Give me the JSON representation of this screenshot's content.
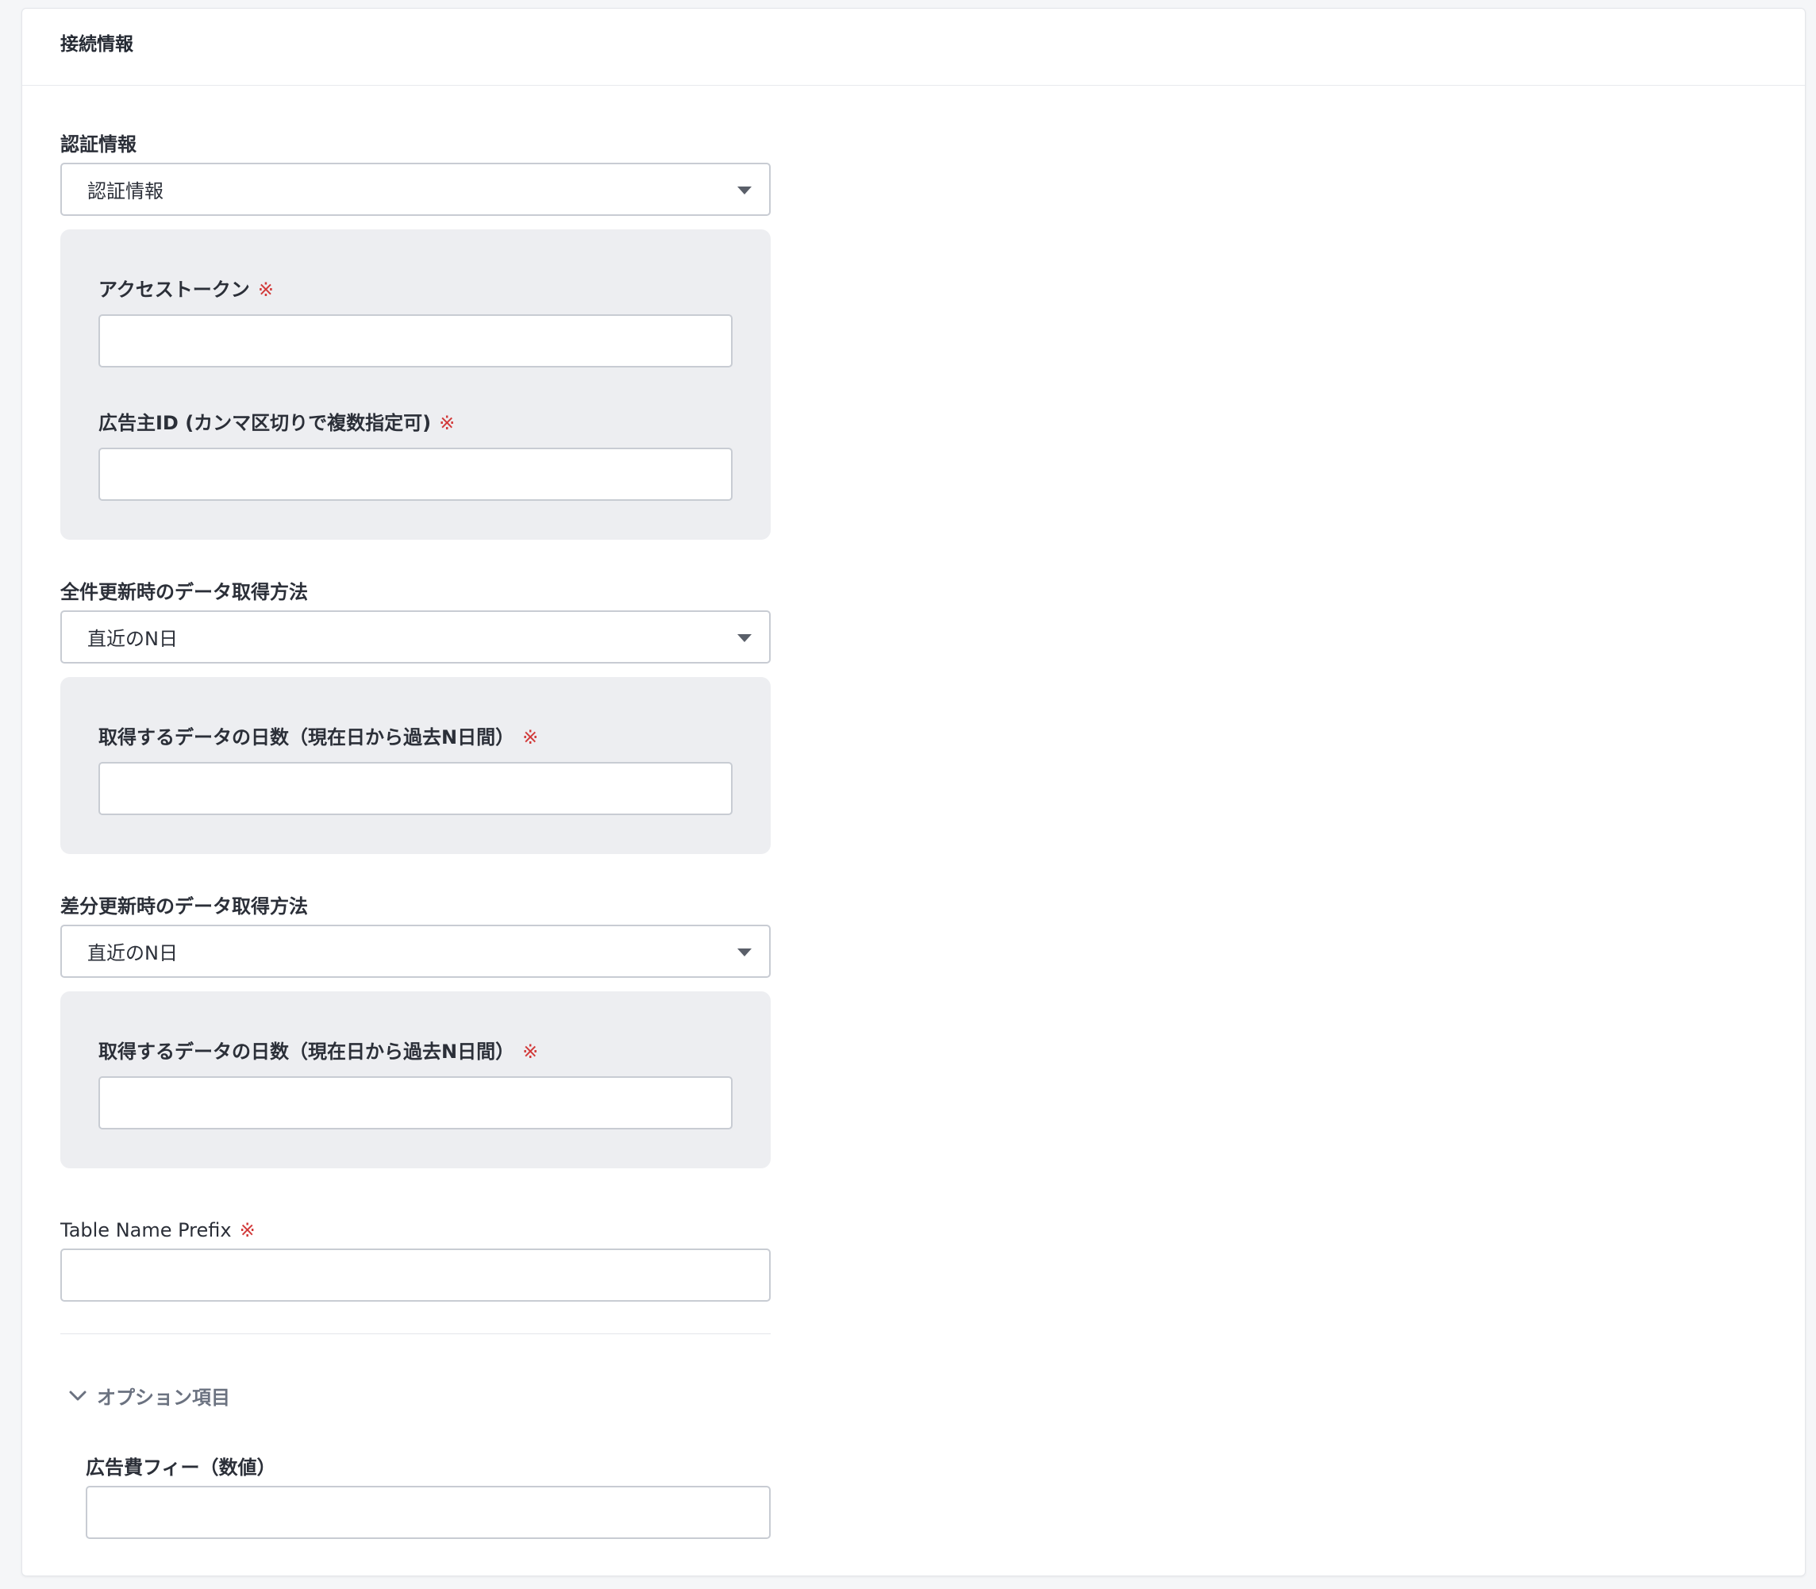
{
  "section": {
    "title": "接続情報"
  },
  "auth": {
    "label": "認証情報",
    "select_value": "認証情報",
    "access_token": {
      "label": "アクセストークン",
      "required_mark": "※",
      "value": ""
    },
    "advertiser_id": {
      "label": "広告主ID (カンマ区切りで複数指定可)",
      "required_mark": "※",
      "value": ""
    }
  },
  "full_update": {
    "label": "全件更新時のデータ取得方法",
    "select_value": "直近のN日",
    "days": {
      "label": "取得するデータの日数（現在日から過去N日間）",
      "required_mark": "※",
      "value": ""
    }
  },
  "diff_update": {
    "label": "差分更新時のデータ取得方法",
    "select_value": "直近のN日",
    "days": {
      "label": "取得するデータの日数（現在日から過去N日間）",
      "required_mark": "※",
      "value": ""
    }
  },
  "table_prefix": {
    "label": "Table Name Prefix",
    "required_mark": "※",
    "value": ""
  },
  "options": {
    "toggle_label": "オプション項目",
    "ad_fee": {
      "label": "広告費フィー（数値）",
      "value": ""
    }
  },
  "colors": {
    "required": "#d23a3a",
    "panel_bg": "#edeef1",
    "border": "#c8ccd3"
  }
}
